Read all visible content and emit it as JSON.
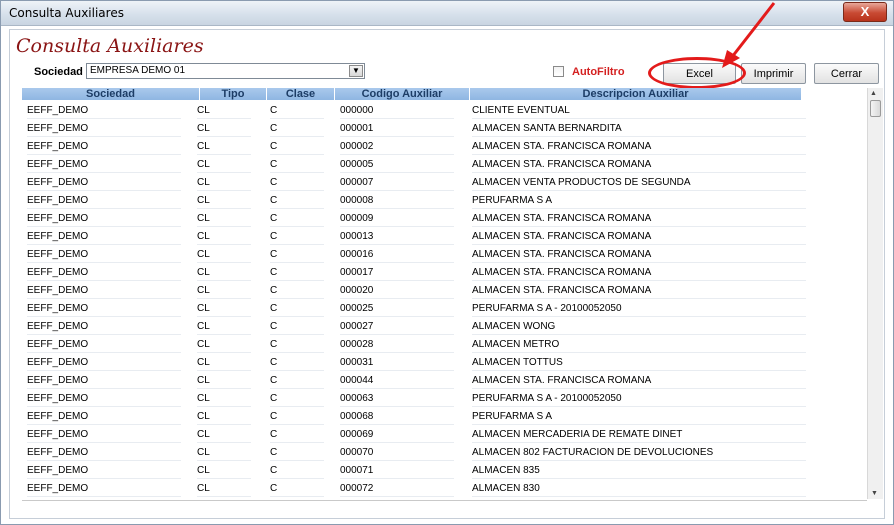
{
  "window": {
    "title": "Consulta  Auxiliares",
    "close_label": "X"
  },
  "page_title": "Consulta Auxiliares",
  "sociedad": {
    "label": "Sociedad",
    "value": "EMPRESA DEMO 01"
  },
  "autofiltro": {
    "label": "AutoFiltro",
    "checked": false
  },
  "buttons": {
    "excel": "Excel",
    "imprimir": "Imprimir",
    "cerrar": "Cerrar"
  },
  "annotation": {
    "color": "#e31b1b"
  },
  "grid": {
    "columns": [
      "Sociedad",
      "Tipo",
      "Clase",
      "Codigo Auxiliar",
      "Descripcion Auxiliar"
    ],
    "rows": [
      [
        "EEFF_DEMO",
        "CL",
        "C",
        "000000",
        "CLIENTE EVENTUAL"
      ],
      [
        "EEFF_DEMO",
        "CL",
        "C",
        "000001",
        "ALMACEN SANTA BERNARDITA"
      ],
      [
        "EEFF_DEMO",
        "CL",
        "C",
        "000002",
        "ALMACEN STA. FRANCISCA ROMANA"
      ],
      [
        "EEFF_DEMO",
        "CL",
        "C",
        "000005",
        "ALMACEN STA. FRANCISCA ROMANA"
      ],
      [
        "EEFF_DEMO",
        "CL",
        "C",
        "000007",
        "ALMACEN VENTA PRODUCTOS DE SEGUNDA"
      ],
      [
        "EEFF_DEMO",
        "CL",
        "C",
        "000008",
        "PERUFARMA S A"
      ],
      [
        "EEFF_DEMO",
        "CL",
        "C",
        "000009",
        "ALMACEN STA. FRANCISCA ROMANA"
      ],
      [
        "EEFF_DEMO",
        "CL",
        "C",
        "000013",
        "ALMACEN STA. FRANCISCA ROMANA"
      ],
      [
        "EEFF_DEMO",
        "CL",
        "C",
        "000016",
        "ALMACEN STA. FRANCISCA ROMANA"
      ],
      [
        "EEFF_DEMO",
        "CL",
        "C",
        "000017",
        "ALMACEN STA. FRANCISCA ROMANA"
      ],
      [
        "EEFF_DEMO",
        "CL",
        "C",
        "000020",
        "ALMACEN STA. FRANCISCA ROMANA"
      ],
      [
        "EEFF_DEMO",
        "CL",
        "C",
        "000025",
        "PERUFARMA S A - 20100052050"
      ],
      [
        "EEFF_DEMO",
        "CL",
        "C",
        "000027",
        "ALMACEN WONG"
      ],
      [
        "EEFF_DEMO",
        "CL",
        "C",
        "000028",
        "ALMACEN METRO"
      ],
      [
        "EEFF_DEMO",
        "CL",
        "C",
        "000031",
        "ALMACEN TOTTUS"
      ],
      [
        "EEFF_DEMO",
        "CL",
        "C",
        "000044",
        "ALMACEN STA. FRANCISCA ROMANA"
      ],
      [
        "EEFF_DEMO",
        "CL",
        "C",
        "000063",
        "PERUFARMA S A - 20100052050"
      ],
      [
        "EEFF_DEMO",
        "CL",
        "C",
        "000068",
        "PERUFARMA S A"
      ],
      [
        "EEFF_DEMO",
        "CL",
        "C",
        "000069",
        "ALMACEN MERCADERIA DE REMATE DINET"
      ],
      [
        "EEFF_DEMO",
        "CL",
        "C",
        "000070",
        "ALMACEN 802 FACTURACION DE DEVOLUCIONES"
      ],
      [
        "EEFF_DEMO",
        "CL",
        "C",
        "000071",
        "ALMACEN 835"
      ],
      [
        "EEFF_DEMO",
        "CL",
        "C",
        "000072",
        "ALMACEN 830"
      ]
    ]
  }
}
